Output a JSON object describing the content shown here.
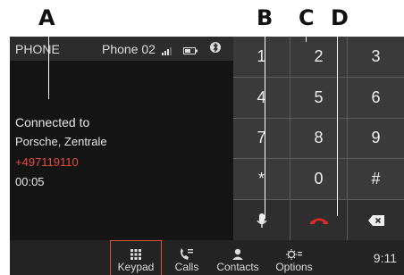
{
  "callouts": [
    "A",
    "B",
    "C",
    "D"
  ],
  "status": {
    "title": "PHONE",
    "phone_name": "Phone 02"
  },
  "call": {
    "connected_label": "Connected to",
    "contact": "Porsche, Zentrale",
    "number": "+497119110",
    "duration": "00:05"
  },
  "keypad": {
    "keys": [
      "1",
      "2",
      "3",
      "4",
      "5",
      "6",
      "7",
      "8",
      "9",
      "*",
      "0",
      "#"
    ],
    "mic": "microphone-icon",
    "hangup": "hang-up-icon",
    "delete": "backspace-icon"
  },
  "tabs": [
    {
      "label": "Keypad",
      "icon": "keypad-icon",
      "active": true
    },
    {
      "label": "Calls",
      "icon": "calls-icon"
    },
    {
      "label": "Contacts",
      "icon": "contacts-icon"
    },
    {
      "label": "Options",
      "icon": "options-icon"
    }
  ],
  "clock": "9:11",
  "colors": {
    "accent": "#e0523a",
    "number": "#e84a3e",
    "hangup": "#e02828"
  }
}
